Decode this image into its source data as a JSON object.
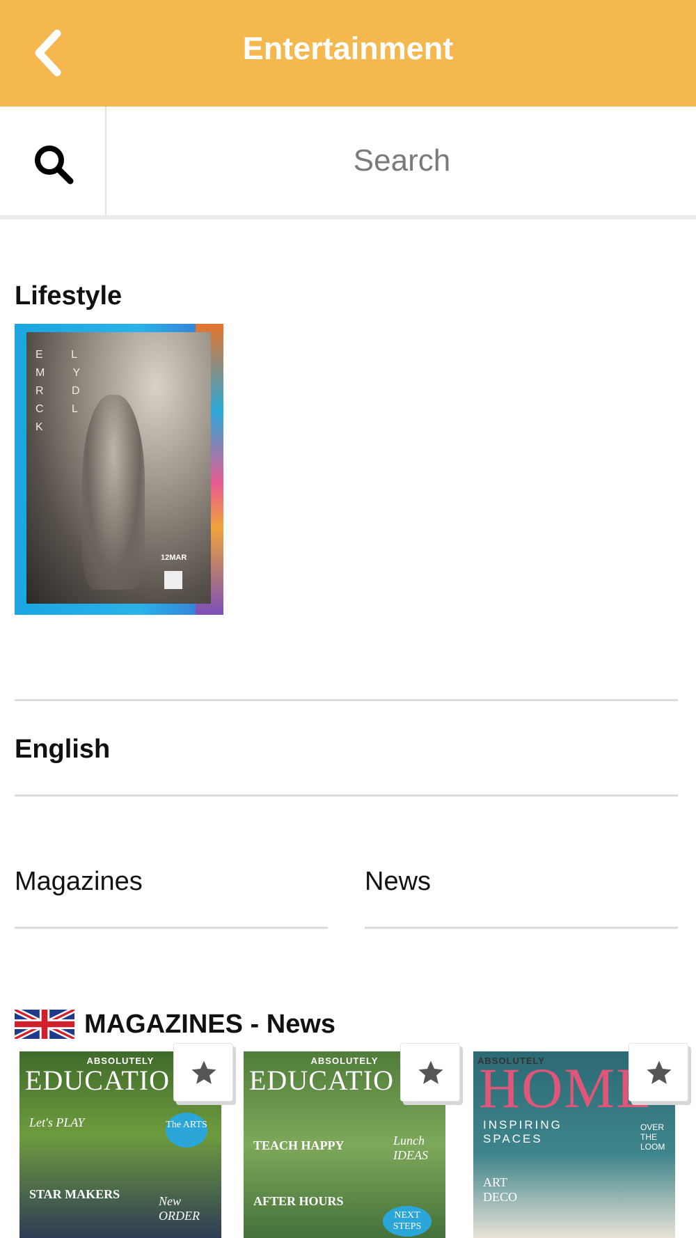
{
  "header": {
    "title": "Entertainment",
    "back_icon": "chevron-left-icon",
    "color": "#f5b84f"
  },
  "search": {
    "icon": "search-icon",
    "placeholder": "Search"
  },
  "lifestyle": {
    "title": "Lifestyle",
    "cover": {
      "letters": "E L M Y R D C L K",
      "date": "12MAR"
    }
  },
  "language": {
    "label": "English"
  },
  "categories": [
    {
      "label": "Magazines"
    },
    {
      "label": "News"
    }
  ],
  "magazines_news": {
    "flag_icon": "uk-flag-icon",
    "title": "MAGAZINES - News",
    "covers": [
      {
        "top_label": "ABSOLUTELY",
        "masthead": "EDUCATIO",
        "lines": [
          "Let's PLAY",
          "STAR MAKERS",
          "The ARTS",
          "New ORDER"
        ],
        "colors": [
          "#4f7a2e",
          "#7fa84a"
        ]
      },
      {
        "top_label": "ABSOLUTELY",
        "masthead": "EDUCATIO",
        "lines": [
          "TEACH HAPPY",
          "Lunch IDEAS",
          "AFTER HOURS",
          "NEXT STEPS"
        ],
        "colors": [
          "#5f8a45",
          "#8fb36a"
        ]
      },
      {
        "top_label": "ABSOLUTELY",
        "masthead": "HOME",
        "lines": [
          "INSPIRING SPACES",
          "ART DECO",
          "OVER THE LOOM"
        ],
        "colors": [
          "#2f6f78",
          "#4b8c92"
        ]
      }
    ]
  }
}
